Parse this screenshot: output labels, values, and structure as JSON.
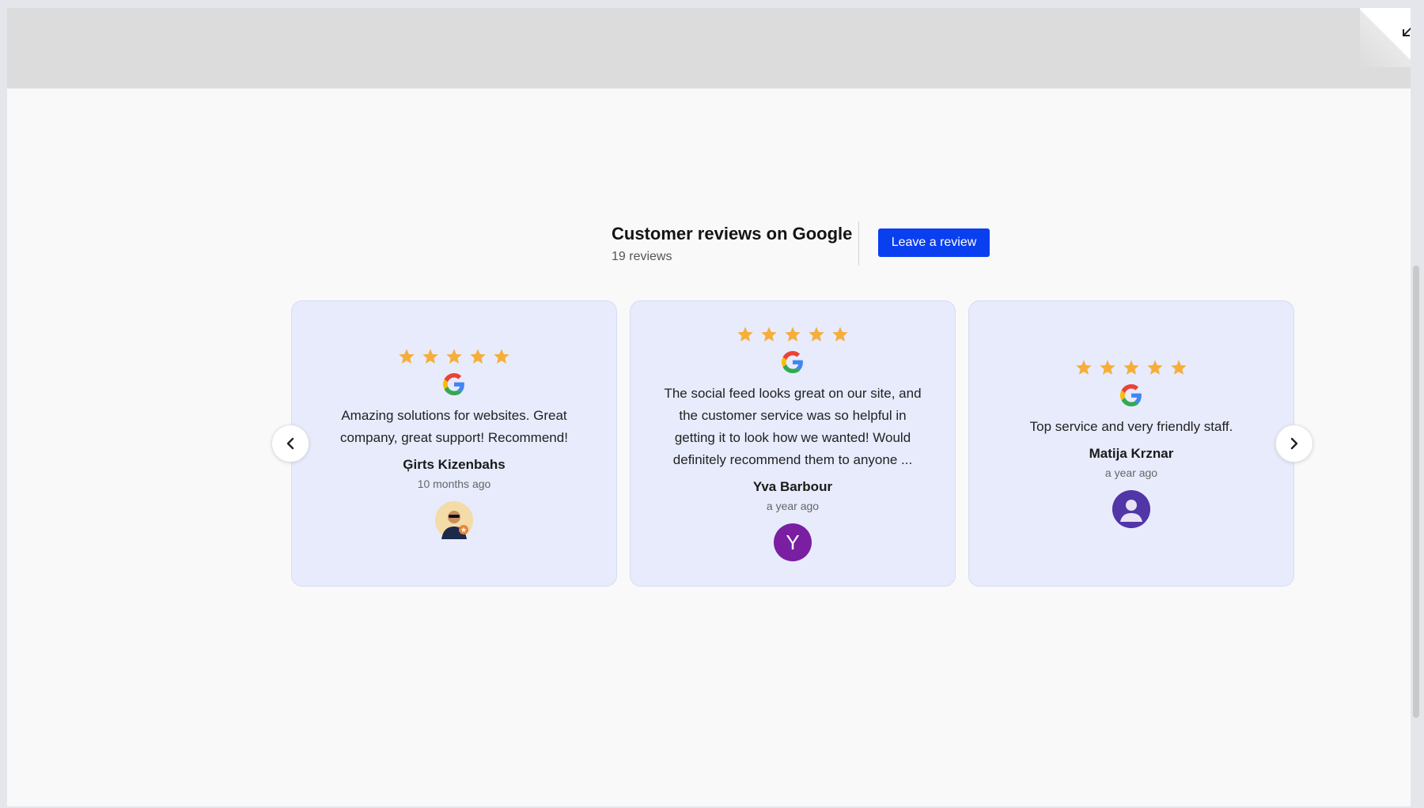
{
  "header": {
    "title": "Customer reviews on Google",
    "count": "19 reviews",
    "leave_review_label": "Leave a review"
  },
  "reviews": [
    {
      "rating": 5,
      "source_icon": "google-icon",
      "text": "Amazing solutions for websites. Great company, great support! Recommend!",
      "author": "Ģirts Kizenbahs",
      "time": "10 months ago",
      "avatar_type": "photo"
    },
    {
      "rating": 5,
      "source_icon": "google-icon",
      "text": "The social feed looks great on our site, and the customer service was so helpful in getting it to look how we wanted! Would definitely recommend them to anyone ...",
      "author": "Yva Barbour",
      "time": "a year ago",
      "avatar_type": "letter",
      "avatar_letter": "Y",
      "avatar_color": "#7a1fa2"
    },
    {
      "rating": 5,
      "source_icon": "google-icon",
      "text": "Top service and very friendly staff.",
      "author": "Matija Krznar",
      "time": "a year ago",
      "avatar_type": "default-user",
      "avatar_color": "#5136a8"
    }
  ],
  "icons": {
    "prev": "chevron-left-icon",
    "next": "chevron-right-icon",
    "collapse": "arrow-down-left-icon",
    "star": "star-icon"
  },
  "colors": {
    "accent": "#0a3ff0",
    "star": "#f6ae3a",
    "card_bg": "#e7ebfc",
    "page_bg": "#f9f9f9"
  }
}
